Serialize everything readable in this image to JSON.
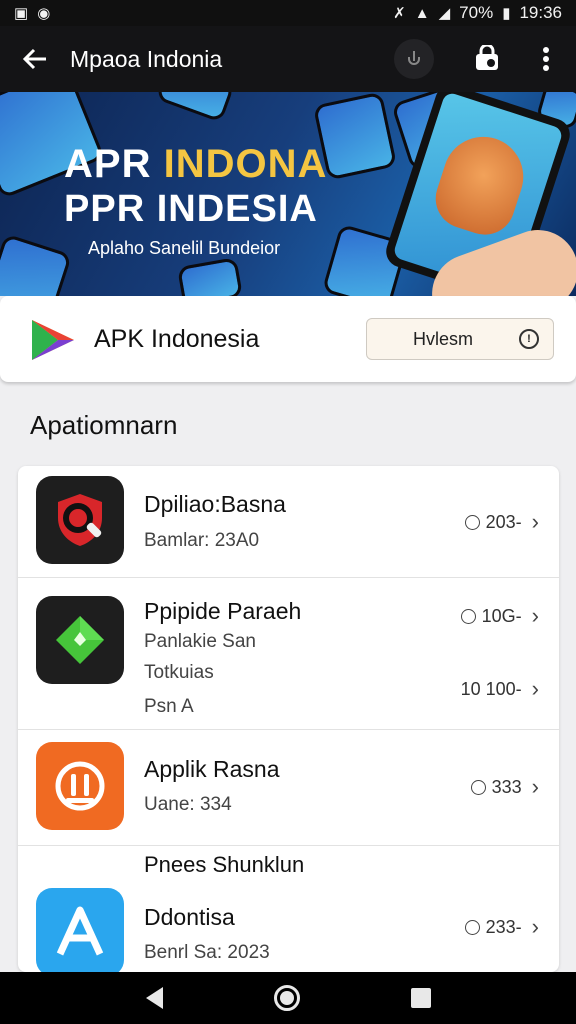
{
  "status_bar": {
    "time": "19:36",
    "battery": "70%"
  },
  "app_bar": {
    "title": "Mpaoa Indonia"
  },
  "banner": {
    "title_line1_part1": "APR ",
    "title_line1_part2": "INDONA",
    "title_line2": "PPR INDESIA",
    "subtitle": "Aplaho Sanelil Bundeior",
    "accent_color": "#f4c542"
  },
  "brand": {
    "name": "APK Indonesia",
    "button_label": "Hvlesm",
    "button_icon": "info-icon"
  },
  "section": {
    "title": "Apatiomnarn"
  },
  "apps": [
    {
      "title": "Dpiliao:Basna",
      "lines": [
        "Bamlar: 23A0"
      ],
      "meta": "203-",
      "icon": "magnifier-icon",
      "icon_color": "#1e1e1e",
      "accent_color": "#d8262a"
    },
    {
      "title": "Ppipide Paraeh",
      "lines": [
        "Panlakie San",
        "Totkuias",
        "Psn A"
      ],
      "meta": "10G-",
      "meta_secondary": "10 100-",
      "icon": "diamond-icon",
      "icon_color": "#1e1e1e",
      "accent_color": "#46c53a"
    },
    {
      "title": "Applik Rasna",
      "lines": [
        "Uane: 334"
      ],
      "meta": "333",
      "icon": "tools-icon",
      "icon_color": "#f06a22",
      "accent_color": "#ffffff"
    },
    {
      "section_header": "Pnees Shunklun",
      "title": "Ddontisa",
      "lines": [
        "Benrl Sa: 2023"
      ],
      "meta": "233-",
      "icon": "letter-a-icon",
      "icon_color": "#2aa6ee",
      "accent_color": "#ffffff"
    }
  ]
}
